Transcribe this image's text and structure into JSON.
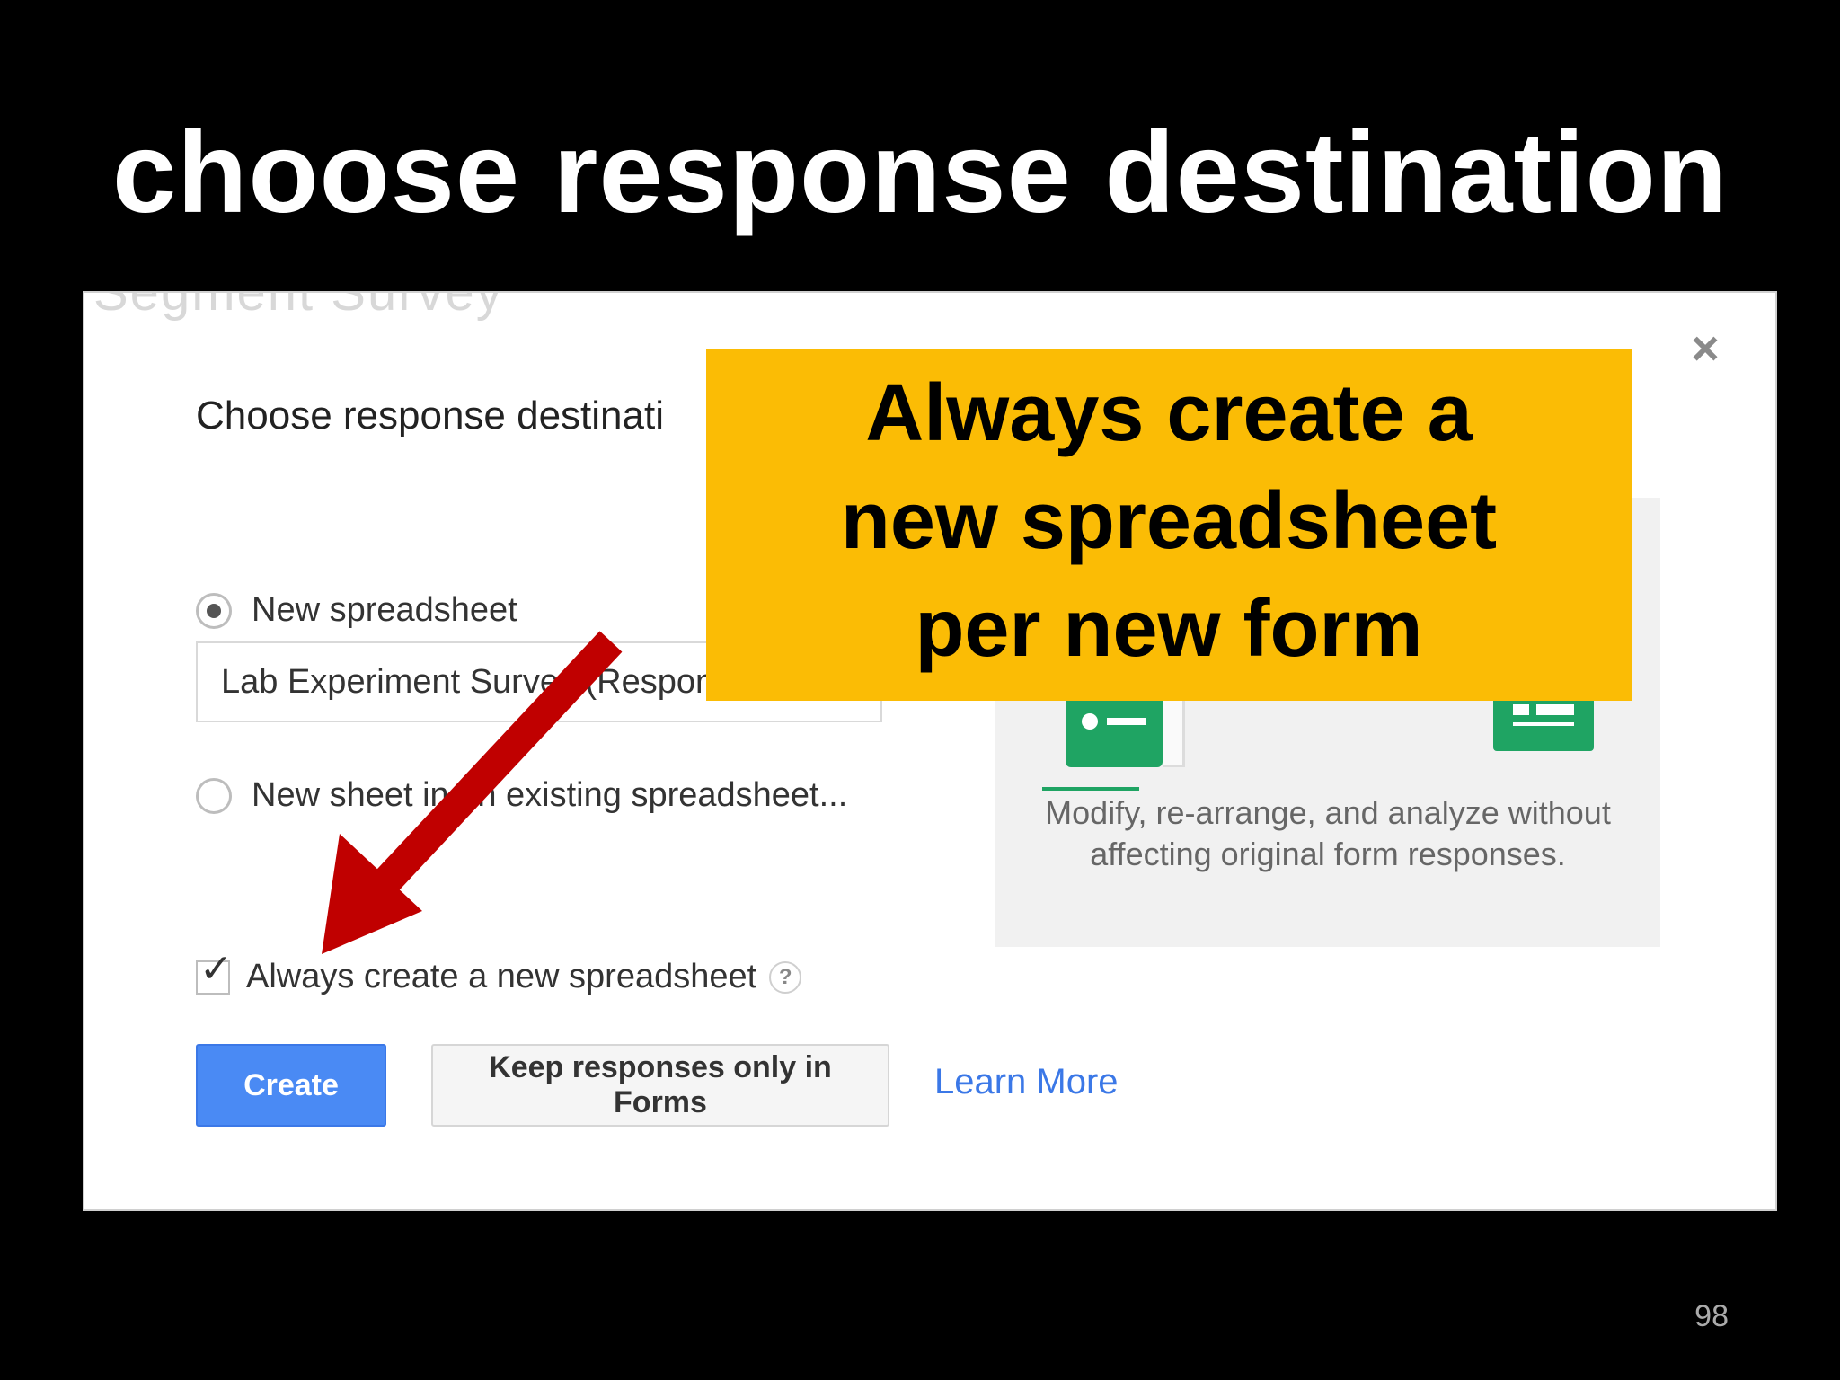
{
  "slide": {
    "title": "choose response destination",
    "page_number": "98"
  },
  "dialog": {
    "background_text": "Segment Survey",
    "title": "Choose response destinati",
    "close_symbol": "×",
    "option_new": {
      "label": "New spreadsheet",
      "selected": true,
      "input_value": "Lab Experiment Survey (Responses)"
    },
    "option_existing": {
      "label": "New sheet in an existing spreadsheet...",
      "selected": false
    },
    "preview_caption": "Modify, re-arrange, and analyze without affecting original form responses.",
    "preview_icons": [
      "form-icon",
      "spreadsheet-icon"
    ],
    "always_create": {
      "label": "Always create a new spreadsheet",
      "checked": true,
      "help_symbol": "?",
      "check_symbol": "✓"
    },
    "buttons": {
      "create": "Create",
      "keep": "Keep responses only in Forms",
      "learn_more": "Learn More"
    }
  },
  "callout": {
    "lines": [
      "Always create a",
      "new spreadsheet",
      "per new form"
    ]
  },
  "colors": {
    "callout_bg": "#fbbc05",
    "arrow": "#c00000",
    "create_button": "#4a8af4",
    "link": "#3b78e7",
    "icon_green": "#1fa463"
  }
}
